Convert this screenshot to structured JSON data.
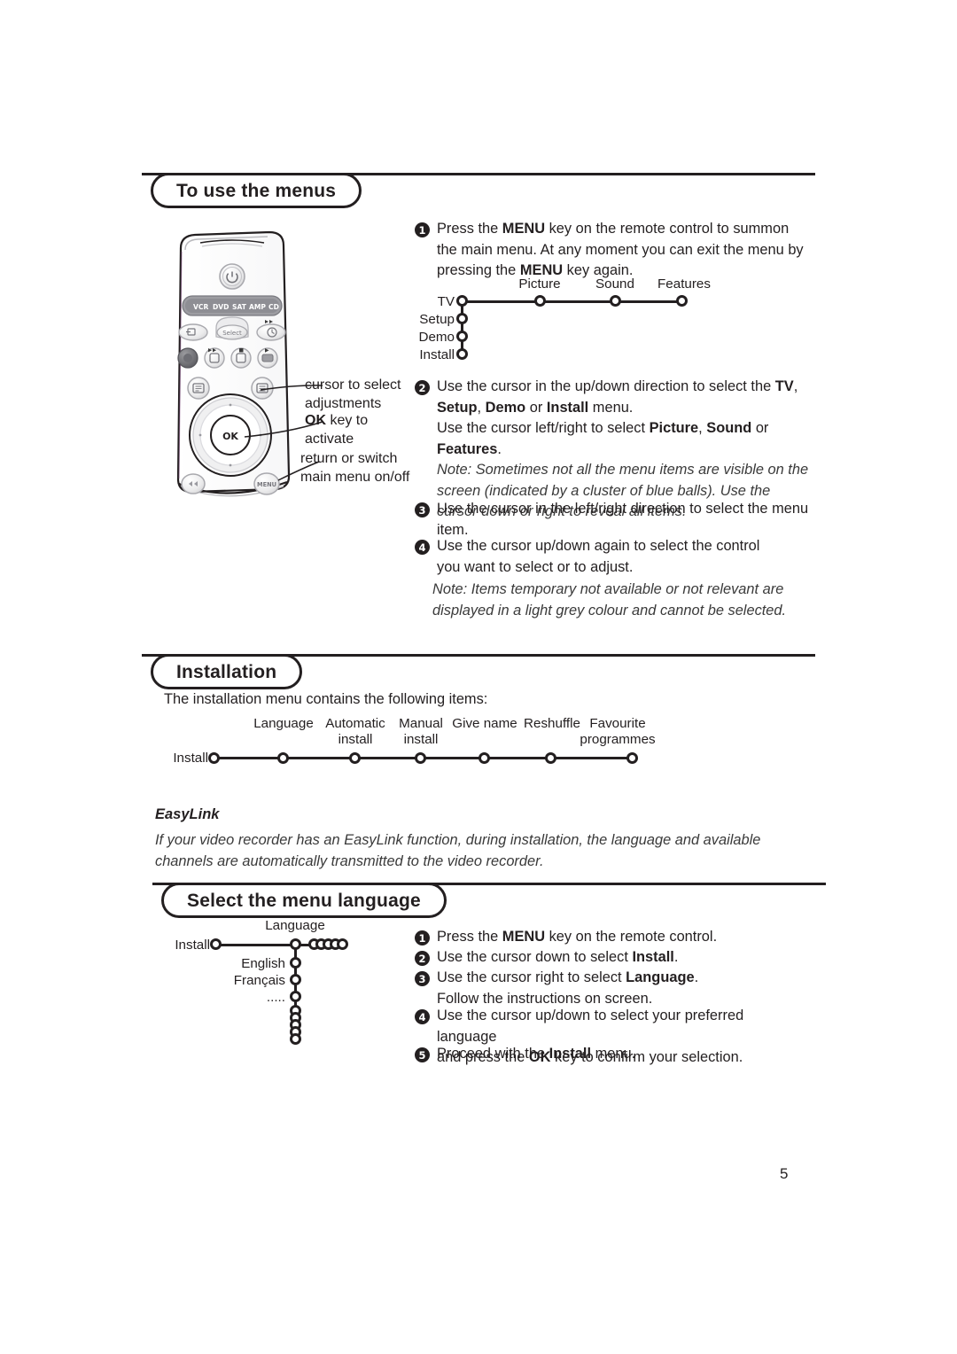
{
  "document": {
    "page_number": "5"
  },
  "sections": [
    {
      "id": "to-use-the-menus",
      "title": "To use the menus"
    },
    {
      "id": "installation",
      "title": "Installation"
    },
    {
      "id": "select-the-menu-language",
      "title": "Select the menu language"
    }
  ],
  "menus_section": {
    "title": "To use the menus",
    "steps": [
      {
        "num": "1",
        "parts": [
          {
            "t": "Press the ",
            "style": "normal"
          },
          {
            "t": "MENU",
            "style": "bold"
          },
          {
            "t": " key on the remote control to summon the main menu. At any moment you can exit the menu by pressing the ",
            "style": "normal"
          },
          {
            "t": "MENU",
            "style": "bold"
          },
          {
            "t": " key again.",
            "style": "normal"
          }
        ]
      },
      {
        "num": "2",
        "parts": [
          {
            "t": "Use the cursor in the up/down direction to select the ",
            "style": "normal"
          },
          {
            "t": "TV",
            "style": "bold"
          },
          {
            "t": ", ",
            "style": "normal"
          },
          {
            "t": "Setup",
            "style": "bold"
          },
          {
            "t": ", ",
            "style": "normal"
          },
          {
            "t": "Demo",
            "style": "bold"
          },
          {
            "t": " or ",
            "style": "normal"
          },
          {
            "t": "Install",
            "style": "bold"
          },
          {
            "t": " menu.",
            "style": "normal"
          },
          {
            "t": "BR",
            "style": "break"
          },
          {
            "t": "Use the cursor left/right to select ",
            "style": "normal"
          },
          {
            "t": "Picture",
            "style": "bold"
          },
          {
            "t": ", ",
            "style": "normal"
          },
          {
            "t": "Sound",
            "style": "bold"
          },
          {
            "t": " or ",
            "style": "normal"
          },
          {
            "t": "Features",
            "style": "bold"
          },
          {
            "t": ".",
            "style": "normal"
          }
        ],
        "note": "Note: Sometimes not all the menu items are visible on the screen (indicated by a cluster of blue balls). Use the cursor down or right to reveal all items."
      },
      {
        "num": "3",
        "parts": [
          {
            "t": "Use the cursor in the left/right direction to select the menu item.",
            "style": "normal"
          }
        ]
      },
      {
        "num": "4",
        "parts": [
          {
            "t": "Use the cursor up/down again to select the control you want to select or to adjust.",
            "style": "normal"
          }
        ]
      }
    ],
    "footer_note": "Note: Items temporary not available or not relevant are displayed in a light grey colour and cannot be selected."
  },
  "tv_menu_diagram": {
    "vertical_items": [
      "TV",
      "Setup",
      "Demo",
      "Install"
    ],
    "horizontal_items": [
      "Picture",
      "Sound",
      "Features"
    ]
  },
  "remote": {
    "device_buttons": [
      "VCR",
      "DVD",
      "SAT",
      "AMP",
      "CD"
    ],
    "select_label": "Select",
    "ok_label": "OK",
    "menu_label": "MENU",
    "callouts": [
      {
        "id": "cursor",
        "lines": [
          "cursor to select",
          "adjustments"
        ],
        "bold_prefix": ""
      },
      {
        "id": "ok",
        "lines": [
          "OK key to",
          "activate"
        ],
        "bold_prefix": "OK"
      },
      {
        "id": "menu",
        "lines": [
          "return or switch",
          "main menu on/off"
        ],
        "bold_prefix": ""
      }
    ]
  },
  "installation_section": {
    "title": "Installation",
    "intro": "The installation menu contains the following items:",
    "root_label": "Install",
    "items": [
      "Language",
      "Automatic install",
      "Manual install",
      "Give name",
      "Reshuffle",
      "Favourite programmes"
    ],
    "easylink": {
      "heading": "EasyLink",
      "body": "If your video recorder has an EasyLink function, during installation, the language and available channels are automatically transmitted to the video recorder."
    }
  },
  "language_section": {
    "title": "Select the menu language",
    "diagram": {
      "root_label": "Install",
      "branch_label": "Language",
      "options": [
        "English",
        "Français",
        "....."
      ]
    },
    "steps": [
      {
        "num": "1",
        "parts": [
          {
            "t": "Press the ",
            "style": "normal"
          },
          {
            "t": "MENU",
            "style": "bold"
          },
          {
            "t": " key on the remote control.",
            "style": "normal"
          }
        ]
      },
      {
        "num": "2",
        "parts": [
          {
            "t": "Use the cursor down to select ",
            "style": "normal"
          },
          {
            "t": "Install",
            "style": "bold"
          },
          {
            "t": ".",
            "style": "normal"
          }
        ]
      },
      {
        "num": "3",
        "parts": [
          {
            "t": "Use the cursor right to select ",
            "style": "normal"
          },
          {
            "t": "Language",
            "style": "bold"
          },
          {
            "t": ".",
            "style": "normal"
          },
          {
            "t": "BR",
            "style": "break"
          },
          {
            "t": "Follow the instructions on screen.",
            "style": "normal"
          }
        ]
      },
      {
        "num": "4",
        "parts": [
          {
            "t": "Use the cursor up/down to select your preferred language and press the ",
            "style": "normal"
          },
          {
            "t": "OK",
            "style": "bold"
          },
          {
            "t": " key to confirm your selection.",
            "style": "normal"
          }
        ]
      },
      {
        "num": "5",
        "parts": [
          {
            "t": "Proceed with the ",
            "style": "normal"
          },
          {
            "t": "Install",
            "style": "bold"
          },
          {
            "t": " menu.",
            "style": "normal"
          }
        ]
      }
    ]
  },
  "colors": {
    "ink": "#231f20",
    "muted": "#3a3a3a",
    "paper": "#ffffff"
  }
}
